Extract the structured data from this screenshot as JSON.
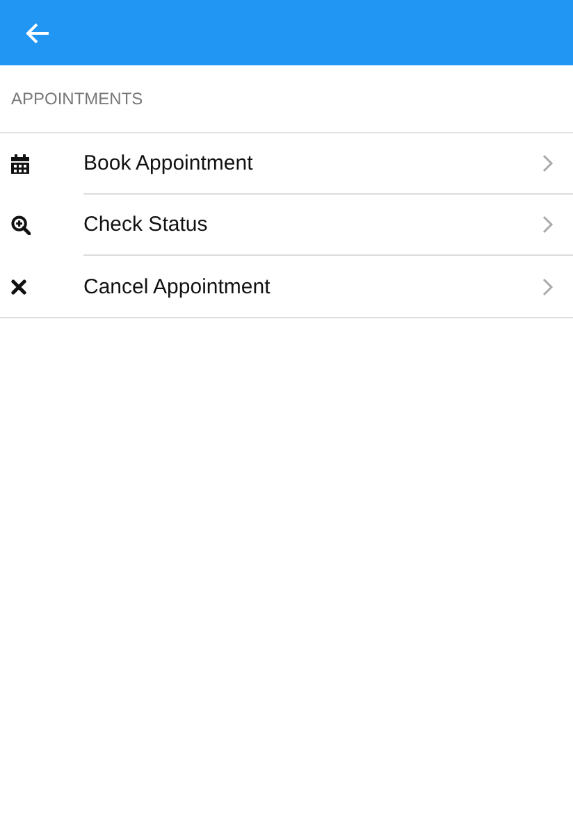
{
  "section": {
    "title": "APPOINTMENTS"
  },
  "items": [
    {
      "kind": "calendar",
      "label": "Book Appointment"
    },
    {
      "kind": "zoom",
      "label": "Check Status"
    },
    {
      "kind": "cancel",
      "label": "Cancel Appointment"
    }
  ]
}
